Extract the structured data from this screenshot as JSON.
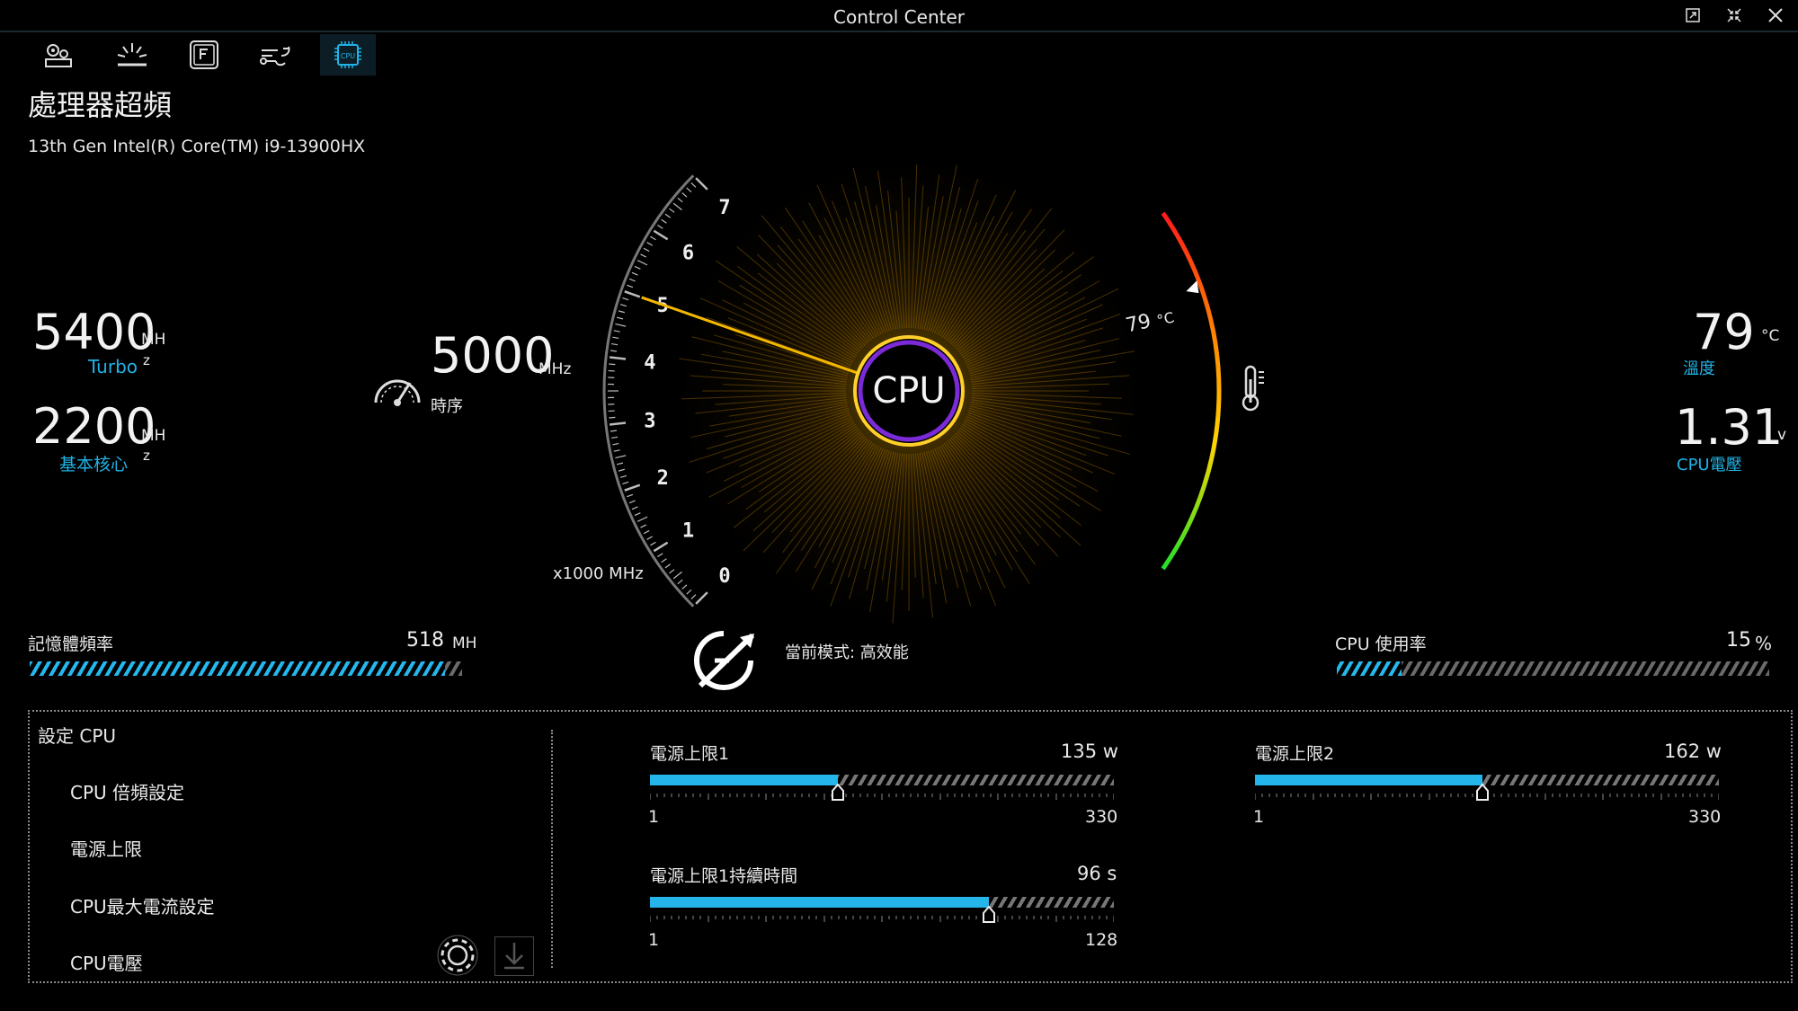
{
  "window": {
    "title": "Control Center"
  },
  "nav": {
    "tabs": [
      {
        "name": "system-settings-icon"
      },
      {
        "name": "lighting-icon"
      },
      {
        "name": "fn-key-icon"
      },
      {
        "name": "fan-icon"
      },
      {
        "name": "cpu-icon",
        "active": true
      }
    ]
  },
  "page": {
    "title": "處理器超頻",
    "cpu_model": "13th Gen Intel(R) Core(TM) i9-13900HX"
  },
  "left_stats": {
    "turbo": {
      "value": "5400",
      "unit_a": "MH",
      "unit_b": "z",
      "label": "Turbo"
    },
    "base": {
      "value": "2200",
      "unit_a": "MH",
      "unit_b": "z",
      "label": "基本核心"
    }
  },
  "clock": {
    "value": "5000",
    "unit": "MHz",
    "label": "時序"
  },
  "gauge": {
    "center_label": "CPU",
    "scale_labels": [
      "0",
      "1",
      "2",
      "3",
      "4",
      "5",
      "6",
      "7"
    ],
    "scale_unit": "x1000 MHz",
    "needle_value": 5.0,
    "temp_marker": "79",
    "temp_marker_unit": "°C",
    "temp_level": 0.79
  },
  "right_stats": {
    "temp": {
      "value": "79",
      "unit": "°C",
      "label": "溫度"
    },
    "voltage": {
      "value": "1.31",
      "unit": "v",
      "label": "CPU電壓"
    }
  },
  "memory": {
    "label": "記憶體頻率",
    "value": "518",
    "unit": "MH",
    "fill": 0.96
  },
  "mode": {
    "text": "當前模式: 高效能"
  },
  "cpu_usage": {
    "label": "CPU 使用率",
    "value": "15",
    "unit": "%",
    "fill": 0.15
  },
  "settings": {
    "header": "設定 CPU",
    "items": [
      {
        "label": "CPU 倍頻設定",
        "active": false
      },
      {
        "label": "電源上限",
        "active": true
      },
      {
        "label": "CPU最大電流設定",
        "active": false
      },
      {
        "label": "CPU電壓",
        "active": false
      }
    ]
  },
  "power": {
    "pl1": {
      "label": "電源上限1",
      "value": "135",
      "unit": "w",
      "min": "1",
      "max": "330",
      "fraction": 0.405
    },
    "pl2": {
      "label": "電源上限2",
      "value": "162",
      "unit": "w",
      "min": "1",
      "max": "330",
      "fraction": 0.49
    },
    "tau": {
      "label": "電源上限1持續時間",
      "value": "96",
      "unit": "s",
      "min": "1",
      "max": "128",
      "fraction": 0.73
    }
  },
  "colors": {
    "accent": "#1fb3e6",
    "needle": "#f5b800",
    "ring": "#8a2be2"
  }
}
